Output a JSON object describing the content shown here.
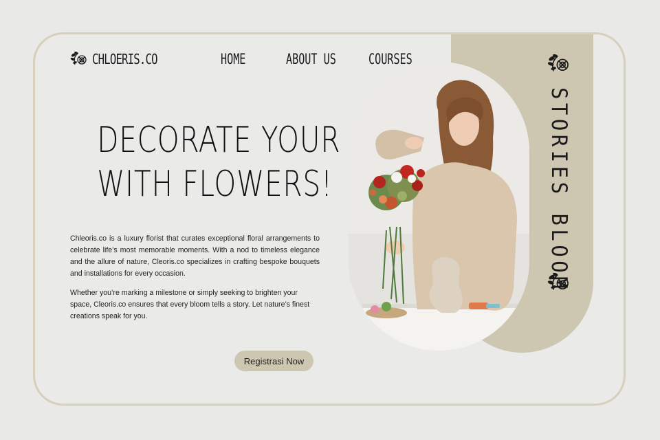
{
  "brand": {
    "name": "CHLOERIS.CO",
    "logo_icon": "flower-cluster-icon"
  },
  "nav": {
    "home": "HOME",
    "about": "ABOUT US",
    "courses": "COURSES"
  },
  "hero": {
    "headline_line1": "DECORATE YOUR LIFE",
    "headline_line2": "WITH FLOWERS!",
    "paragraph1": "Chleoris.co is a luxury florist that curates exceptional floral arrangements to celebrate life’s most memorable moments. With a nod to timeless elegance and the allure of nature, Cleoris.co specializes in crafting bespoke bouquets and installations for every occasion.",
    "paragraph2": "Whether you’re marking a milestone or simply seeking to brighten your space, Cleoris.co ensures that every bloom tells a story. Let nature’s finest creations speak for you.",
    "cta_label": "Registrasi Now"
  },
  "side": {
    "vertical_text": "STORIES BLOOM",
    "icon_top": "flower-cluster-icon",
    "icon_bottom": "flower-cluster-icon"
  },
  "colors": {
    "background": "#e9e9e8",
    "card_border": "#d6cfba",
    "accent_panel": "#cdc6b1",
    "text": "#111111"
  }
}
